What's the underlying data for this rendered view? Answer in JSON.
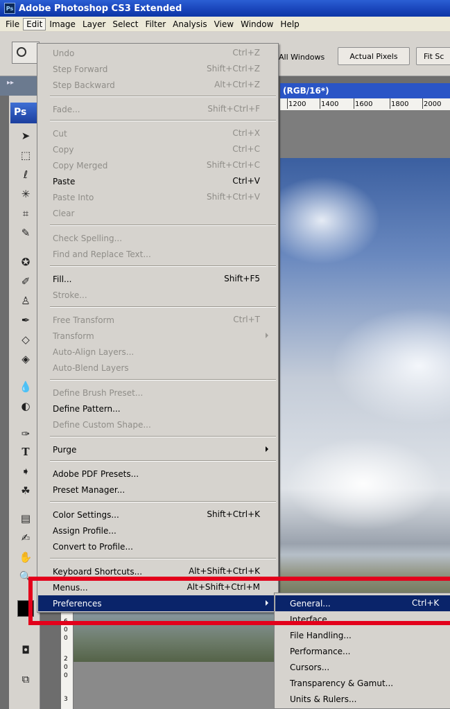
{
  "window": {
    "title": "Adobe Photoshop CS3 Extended",
    "icon_text": "Ps"
  },
  "menubar": {
    "items": [
      {
        "label": "File"
      },
      {
        "label": "Edit"
      },
      {
        "label": "Image"
      },
      {
        "label": "Layer"
      },
      {
        "label": "Select"
      },
      {
        "label": "Filter"
      },
      {
        "label": "Analysis"
      },
      {
        "label": "View"
      },
      {
        "label": "Window"
      },
      {
        "label": "Help"
      }
    ]
  },
  "options_bar": {
    "all_windows_label": "All Windows",
    "actual_pixels_label": "Actual Pixels",
    "fit_screen_label": "Fit Sc"
  },
  "document": {
    "title_fragment": "(RGB/16*)",
    "ruler_ticks": [
      "1200",
      "1400",
      "1600",
      "1800",
      "2000"
    ]
  },
  "toolbox": {
    "logo_text": "Ps",
    "collapse_glyph": "▸▸",
    "left_ruler_labels": [
      "6",
      "0",
      "0",
      "2",
      "0",
      "0",
      "3"
    ]
  },
  "edit_menu": {
    "items": [
      {
        "label": "Undo",
        "shortcut": "Ctrl+Z",
        "disabled": true
      },
      {
        "label": "Step Forward",
        "shortcut": "Shift+Ctrl+Z",
        "disabled": true
      },
      {
        "label": "Step Backward",
        "shortcut": "Alt+Ctrl+Z",
        "disabled": true
      },
      {
        "label": "Fade...",
        "shortcut": "Shift+Ctrl+F",
        "disabled": true
      },
      {
        "label": "Cut",
        "shortcut": "Ctrl+X",
        "disabled": true
      },
      {
        "label": "Copy",
        "shortcut": "Ctrl+C",
        "disabled": true
      },
      {
        "label": "Copy Merged",
        "shortcut": "Shift+Ctrl+C",
        "disabled": true
      },
      {
        "label": "Paste",
        "shortcut": "Ctrl+V",
        "disabled": false
      },
      {
        "label": "Paste Into",
        "shortcut": "Shift+Ctrl+V",
        "disabled": true
      },
      {
        "label": "Clear",
        "shortcut": "",
        "disabled": true
      },
      {
        "label": "Check Spelling...",
        "shortcut": "",
        "disabled": true
      },
      {
        "label": "Find and Replace Text...",
        "shortcut": "",
        "disabled": true
      },
      {
        "label": "Fill...",
        "shortcut": "Shift+F5",
        "disabled": false
      },
      {
        "label": "Stroke...",
        "shortcut": "",
        "disabled": true
      },
      {
        "label": "Free Transform",
        "shortcut": "Ctrl+T",
        "disabled": true
      },
      {
        "label": "Transform",
        "shortcut": "",
        "disabled": true,
        "submenu": true
      },
      {
        "label": "Auto-Align Layers...",
        "shortcut": "",
        "disabled": true
      },
      {
        "label": "Auto-Blend Layers",
        "shortcut": "",
        "disabled": true
      },
      {
        "label": "Define Brush Preset...",
        "shortcut": "",
        "disabled": true
      },
      {
        "label": "Define Pattern...",
        "shortcut": "",
        "disabled": false
      },
      {
        "label": "Define Custom Shape...",
        "shortcut": "",
        "disabled": true
      },
      {
        "label": "Purge",
        "shortcut": "",
        "disabled": false,
        "submenu": true
      },
      {
        "label": "Adobe PDF Presets...",
        "shortcut": "",
        "disabled": false
      },
      {
        "label": "Preset Manager...",
        "shortcut": "",
        "disabled": false
      },
      {
        "label": "Color Settings...",
        "shortcut": "Shift+Ctrl+K",
        "disabled": false
      },
      {
        "label": "Assign Profile...",
        "shortcut": "",
        "disabled": false
      },
      {
        "label": "Convert to Profile...",
        "shortcut": "",
        "disabled": false
      },
      {
        "label": "Keyboard Shortcuts...",
        "shortcut": "Alt+Shift+Ctrl+K",
        "disabled": false
      },
      {
        "label": "Menus...",
        "shortcut": "Alt+Shift+Ctrl+M",
        "disabled": false
      },
      {
        "label": "Preferences",
        "shortcut": "",
        "disabled": false,
        "submenu": true,
        "selected": true
      }
    ]
  },
  "preferences_submenu": {
    "items": [
      {
        "label": "General...",
        "shortcut": "Ctrl+K",
        "selected": true
      },
      {
        "label": "Interface...",
        "shortcut": ""
      },
      {
        "label": "File Handling...",
        "shortcut": ""
      },
      {
        "label": "Performance...",
        "shortcut": ""
      },
      {
        "label": "Cursors...",
        "shortcut": ""
      },
      {
        "label": "Transparency & Gamut...",
        "shortcut": ""
      },
      {
        "label": "Units & Rulers...",
        "shortcut": ""
      }
    ]
  },
  "colors": {
    "menu_highlight": "#0a246a",
    "annotation_red": "#e3001b",
    "title_blue": "#1843b8"
  }
}
